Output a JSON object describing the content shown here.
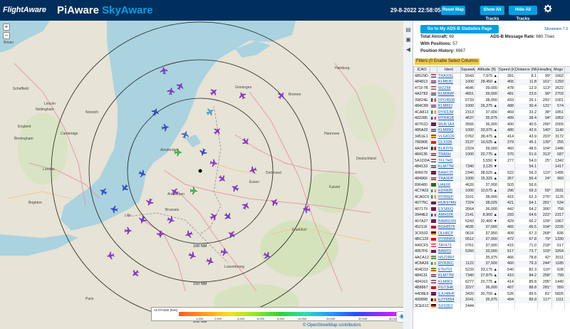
{
  "header": {
    "logo": "FlightAware",
    "brand_main": "PiAware",
    "brand_accent": "SkyAware",
    "clock": "29-8-2022 22:58:05",
    "reset_map": "Reset Map",
    "show_all_tracks": "Show All Tracks",
    "hide_all_tracks": "Hide All Tracks",
    "settings_icon": "gear-icon"
  },
  "colors": {
    "header_bg": "#002f5d",
    "accent": "#00a0e2",
    "filter_tab": "#f3c74a"
  },
  "sidebar": {
    "stats_button": "Go to My ADS-B Statistics Page",
    "version": "Skyaware 7.2",
    "total_aircraft_label": "Total Aircraft:",
    "total_aircraft": "69",
    "with_positions_label": "With Positions:",
    "with_positions": "57",
    "history_label": "Position History:",
    "history": "6967",
    "msg_rate_label": "ADS-B Message Rate:",
    "msg_rate": "660.7/sec",
    "filters_tab": "Filters (0 Enabled)",
    "columns_tab": "Select Columns"
  },
  "table": {
    "headers": [
      "ICAO",
      "",
      "Ident",
      "Squawk",
      "Altitude (ft)",
      "Speed (kt)",
      "Distance (NM)",
      "Heading",
      "Msgs"
    ],
    "rows": [
      [
        "48529D",
        "nl",
        "TRA33G",
        "5543",
        "7,975 ▲",
        "281",
        "8.1",
        "99°",
        "1662"
      ],
      [
        "484813",
        "nl",
        "KLM53C",
        "1000",
        "28,450 ▲",
        "465",
        "11.8",
        "161°",
        "1293"
      ],
      [
        "471F7B",
        "hu",
        "WZZ88",
        "4645",
        "39,000",
        "478",
        "12.9",
        "113°",
        "2622"
      ],
      [
        "4A3782",
        "nl",
        "KLM3MP",
        "4651",
        "39,000",
        "481",
        "23.6",
        "99°",
        "2703"
      ],
      [
        "39824E",
        "fr",
        "FPO4508",
        "0733",
        "38,000",
        "433",
        "26.1",
        "291°",
        "1001"
      ],
      [
        "484C89",
        "nl",
        "KLM83J",
        "1000",
        "26,375 ▲",
        "488",
        "30.4",
        "131°",
        "574"
      ],
      [
        "4CA813",
        "ie",
        "RYR3JM",
        "2313",
        "37,000",
        "469",
        "33.2",
        "38°",
        "1851"
      ],
      [
        "402285",
        "fr",
        "RYR4GB",
        "4637",
        "35,975",
        "499",
        "38.4",
        "94°",
        "1852"
      ],
      [
        "40761D",
        "gb",
        "WUK1AX",
        "3565",
        "36,000",
        "400",
        "40.5",
        "290°",
        "2005"
      ],
      [
        "485A32",
        "nl",
        "KLM99Q",
        "1000",
        "33,975 ▲",
        "480",
        "42.6",
        "140°",
        "1140"
      ],
      [
        "3451E1",
        "es",
        "VLG812F",
        "0762",
        "38,475 ▲",
        "414",
        "43.9",
        "203°",
        "3172"
      ],
      [
        "780968",
        "cn",
        "CLX336",
        "3137",
        "16,625 ▲",
        "379",
        "45.1",
        "130°",
        "255"
      ],
      [
        "4A0544",
        "ro",
        "BLA3YN",
        "2324",
        "39,000",
        "460",
        "48.5",
        "104°",
        "1446"
      ],
      [
        "484135",
        "nl",
        "TRA6H",
        "1000",
        "20,775 ▲",
        "370",
        "51.6",
        "313°",
        "587"
      ],
      [
        "5A1DDA",
        "nl",
        "TFL7HD",
        "",
        "5,550 ▼",
        "277",
        "54.0",
        "25°",
        "1342"
      ],
      [
        "484133",
        "nl",
        "KLM77M",
        "7340",
        "3,125 ▼",
        "",
        "54.1",
        "",
        "1417"
      ],
      [
        "406678",
        "gb",
        "BAW125",
        "2340",
        "38,525 ▲",
        "522",
        "56.3",
        "110°",
        "1495"
      ],
      [
        "484966",
        "nl",
        "TRA3DP",
        "1000",
        "15,325 ▲",
        "357",
        "56.4",
        "24°",
        "993"
      ],
      [
        "896480",
        "ae",
        "UAE66",
        "4626",
        "37,000",
        "503",
        "56.6",
        "",
        ""
      ],
      [
        "4C7A02",
        "ie",
        "EDX835",
        "1000",
        "10,575 ▲",
        "296",
        "59.3",
        "59°",
        "2831"
      ],
      [
        "4CA0C6",
        "ie",
        "RYR5EP",
        "3101",
        "38,000",
        "415",
        "62.3",
        "276°",
        "1125"
      ],
      [
        "40775C",
        "gb",
        "RUK97AN",
        "7224",
        "38,025",
        "421",
        "64.1",
        "281°",
        "534"
      ],
      [
        "407179",
        "gb",
        "EXS86Q",
        "3564",
        "36,000",
        "442",
        "64.2",
        "306°",
        "758"
      ],
      [
        "3944E2",
        "fr",
        "AMX02K",
        "2141",
        "8,900 ▲",
        "293",
        "64.6",
        "222°",
        "2317"
      ],
      [
        "407A37",
        "gb",
        "BAW916N",
        "5243",
        "32,400 ▼",
        "429",
        "66.2",
        "109°",
        "1867"
      ],
      [
        "45211F",
        "dk",
        "BGH6576",
        "4635",
        "37,000",
        "465",
        "66.5",
        "104°",
        "2225"
      ],
      [
        "3C6592",
        "de",
        "DLH8CP",
        "0616",
        "37,950",
        "409",
        "67.3",
        "268°",
        "836"
      ],
      [
        "4BC12F",
        "tr",
        "RYR896X",
        "0512",
        "37,000",
        "472",
        "67.8",
        "79°",
        "1330"
      ],
      [
        "440CF5",
        "at",
        "TAY473",
        "0761",
        "37,000",
        "415",
        "71.0",
        "218°",
        "617"
      ],
      [
        "4067F6",
        "gb",
        "BAW15",
        "5260",
        "33,000",
        "517",
        "73.7",
        "103°",
        "3264"
      ],
      [
        "4ACA12",
        "se",
        "NSZ2897",
        "",
        "35,975",
        "466",
        "78.8",
        "42°",
        "2011"
      ],
      [
        "4C8A26",
        "ie",
        "RYR3KC",
        "1122",
        "37,000",
        "460",
        "79.3",
        "244°",
        "1185"
      ],
      [
        "404D33",
        "et",
        "ETH701",
        "5233",
        "33,175 ▲",
        "540",
        "82.3",
        "116°",
        "628"
      ],
      [
        "484131",
        "nl",
        "KLM77M",
        "7340",
        "27,875 ▲",
        "410",
        "84.2",
        "258°",
        "799"
      ],
      [
        "484163",
        "nl",
        "KLM963",
        "6277",
        "20,775 ▲",
        "414",
        "85.8",
        "295°",
        "1440"
      ],
      [
        "4B8867",
        "tr",
        "PGT3HK",
        "3227",
        "36,000",
        "407",
        "88.8",
        "281°",
        "550"
      ],
      [
        "44D8E9",
        "gb",
        "EJU48HF",
        "3420",
        "30,700 ▲",
        "526",
        "89.5",
        "81°",
        "5825"
      ],
      [
        "400898",
        "be",
        "EZY6564",
        "3241",
        "35,975",
        "494",
        "89.9",
        "117°",
        "1111"
      ],
      [
        "3CE61C",
        "de",
        "SXS3DJ",
        "2444",
        "",
        "",
        "",
        "",
        ""
      ]
    ]
  },
  "map": {
    "zoom_in": "+",
    "zoom_out": "−",
    "ring_100": "100 NM",
    "ring_150": "150 NM",
    "ring_200": "200 NM",
    "cities": [
      "Britain",
      "Scheffield",
      "Lincoln",
      "Nottingham",
      "Norwich",
      "England",
      "Birmingham",
      "Cambridge",
      "London",
      "Brighton",
      "Amsterdam",
      "Brussels",
      "Antwerpen",
      "Essen",
      "Dortmund",
      "Kassel",
      "Lille",
      "Luxembourg",
      "Paris",
      "Frankfurt",
      "Hannover",
      "Bremen",
      "Hamburg",
      "Groningen",
      "Deutschland"
    ],
    "altitude_title": "ALTITUDE (feet)",
    "altitude_labels": [
      "1,000",
      "2,000",
      "4,000",
      "6,000",
      "8,000",
      "10,000",
      "20,000",
      "30,000",
      "40,000"
    ],
    "attribution": "© OpenStreetMap contributors",
    "layers_icon": "layers-icon"
  }
}
